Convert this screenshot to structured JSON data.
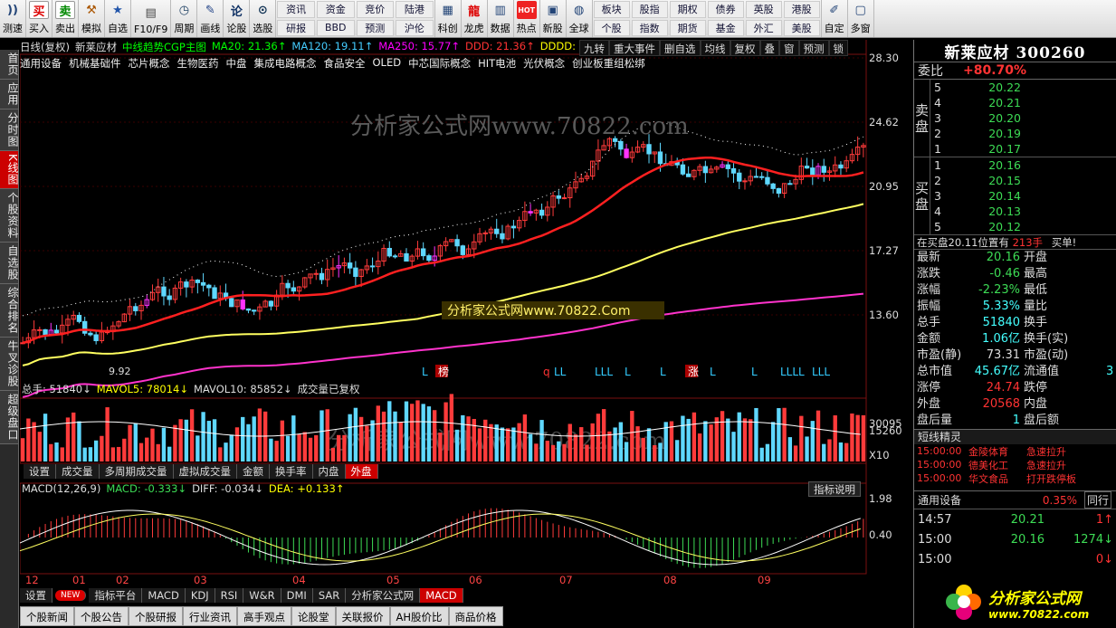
{
  "toolbar": {
    "items": [
      {
        "label": "测速",
        "icon": "wifi"
      },
      {
        "label": "买入",
        "icon": "买"
      },
      {
        "label": "卖出",
        "icon": "卖"
      },
      {
        "label": "模拟",
        "icon": "hammer"
      },
      {
        "label": "自选",
        "icon": "star"
      },
      {
        "label": "F10/F9",
        "icon": "info"
      },
      {
        "label": "周期",
        "icon": "clock"
      },
      {
        "label": "画线",
        "icon": "pen"
      },
      {
        "label": "论股",
        "icon": "论"
      },
      {
        "label": "选股",
        "icon": "search"
      }
    ],
    "grid1": [
      "资讯",
      "资金",
      "竞价",
      "陆港",
      "研报",
      "BBD",
      "预测",
      "沪伦"
    ],
    "items2": [
      {
        "label": "科创",
        "icon": "chart"
      },
      {
        "label": "龙虎",
        "icon": "dragon"
      },
      {
        "label": "数据",
        "icon": "data"
      },
      {
        "label": "热点",
        "icon": "hot"
      },
      {
        "label": "新股",
        "icon": "new"
      },
      {
        "label": "全球",
        "icon": "globe"
      }
    ],
    "grid2": [
      "板块",
      "股指",
      "期权",
      "债券",
      "英股",
      "港股",
      "个股",
      "指数",
      "期货",
      "基金",
      "外汇",
      "美股"
    ],
    "items3": [
      {
        "label": "自定",
        "icon": "custom"
      },
      {
        "label": "多窗",
        "icon": "win"
      }
    ]
  },
  "lefttabs": [
    "首页",
    "应用",
    "分时图",
    "K线图",
    "个股资料",
    "自选股",
    "综合排名",
    "牛叉诊股",
    "超级盘口"
  ],
  "chart": {
    "header1": [
      {
        "t": "日线(复权)",
        "c": "#ddd"
      },
      {
        "t": "新莱应材",
        "c": "#ddd"
      },
      {
        "t": "中线趋势CGP主图",
        "c": "#0f0"
      },
      {
        "t": "MA20: 21.36↑",
        "c": "#0f0"
      },
      {
        "t": "MA120: 19.11↑",
        "c": "#4cf"
      },
      {
        "t": "MA250: 15.77↑",
        "c": "#f0f"
      },
      {
        "t": "DDD: 21.36↑",
        "c": "#f33"
      },
      {
        "t": "DDDD: 1",
        "c": "#ff0"
      }
    ],
    "header2": [
      "通用设备",
      "机械基础件",
      "芯片概念",
      "生物医药",
      "中盘",
      "集成电路概念",
      "食品安全",
      "OLED",
      "中芯国际概念",
      "HIT电池",
      "光伏概念",
      "创业板重组松绑"
    ],
    "topbtns": [
      "九转",
      "重大事件",
      "删自选",
      "均线",
      "复权",
      "叠",
      "窗",
      "预测",
      "锁"
    ],
    "watermark1": "分析家公式网www.70822.com",
    "watermark2": "分析家公式网www.70822.Com",
    "price_ticks": [
      "28.30",
      "24.62",
      "20.95",
      "17.27",
      "13.60"
    ],
    "low_label": "9.92",
    "vol_header": [
      {
        "t": "总手: 51840↓",
        "c": "#ddd"
      },
      {
        "t": "MAVOL5: 78014↓",
        "c": "#ff0"
      },
      {
        "t": "MAVOL10: 85852↓",
        "c": "#ddd"
      },
      {
        "t": "成交量已复权",
        "c": "#ddd"
      }
    ],
    "vol_ticks": [
      "30095",
      "15260",
      "X10"
    ],
    "midtabs": [
      "设置",
      "成交量",
      "多周期成交量",
      "虚拟成交量",
      "金额",
      "换手率",
      "内盘",
      "外盘"
    ],
    "macd_header": [
      {
        "t": "MACD(12,26,9)",
        "c": "#ddd"
      },
      {
        "t": "MACD: -0.333↓",
        "c": "#3ddc55"
      },
      {
        "t": "DIFF: -0.034↓",
        "c": "#ddd"
      },
      {
        "t": "DEA: +0.133↑",
        "c": "#ff0"
      }
    ],
    "macd_btn": "指标说明",
    "macd_ticks": [
      "1.98",
      "0.40"
    ],
    "months": [
      "12",
      "01",
      "02",
      "03",
      "04",
      "05",
      "06",
      "07",
      "08",
      "09"
    ],
    "event_marks": [
      "L",
      "榜",
      "q",
      "LL",
      "LLL",
      "L",
      "L",
      "涨",
      "L",
      "L",
      "LLLL",
      "LLL"
    ],
    "bottomtabs": [
      {
        "t": "设置"
      },
      {
        "t": "NEW",
        "badge": true
      },
      {
        "t": "指标平台"
      },
      {
        "t": "MACD"
      },
      {
        "t": "KDJ"
      },
      {
        "t": "RSI"
      },
      {
        "t": "W&R"
      },
      {
        "t": "DMI"
      },
      {
        "t": "SAR"
      },
      {
        "t": "分析家公式网"
      },
      {
        "t": "MACD",
        "on": true
      }
    ],
    "newstabs": [
      "个股新闻",
      "个股公告",
      "个股研报",
      "行业资讯",
      "高手观点",
      "论股堂",
      "关联报价",
      "AH股价比",
      "商品价格"
    ]
  },
  "panel": {
    "title": "新莱应材 300260",
    "weibi_label": "委比",
    "weibi": "+80.70%",
    "sell_label": "卖盘",
    "buy_label": "买盘",
    "sells": [
      {
        "n": "5",
        "p": "20.22"
      },
      {
        "n": "4",
        "p": "20.21"
      },
      {
        "n": "3",
        "p": "20.20"
      },
      {
        "n": "2",
        "p": "20.19"
      },
      {
        "n": "1",
        "p": "20.17"
      }
    ],
    "buys": [
      {
        "n": "1",
        "p": "20.16"
      },
      {
        "n": "2",
        "p": "20.15"
      },
      {
        "n": "3",
        "p": "20.14"
      },
      {
        "n": "4",
        "p": "20.13"
      },
      {
        "n": "5",
        "p": "20.12"
      }
    ],
    "buyline": "在买盘20.11位置有",
    "buyline_q": "213手",
    "buyline_tail": "买单!",
    "details": [
      [
        "最新",
        "20.16",
        "开盘"
      ],
      [
        "涨跌",
        "-0.46",
        "最高"
      ],
      [
        "涨幅",
        "-2.23%",
        "最低"
      ],
      [
        "振幅",
        "5.33%",
        "量比"
      ],
      [
        "总手",
        "51840",
        "换手"
      ],
      [
        "金额",
        "1.06亿",
        "换手(实)"
      ],
      [
        "市盈(静)",
        "73.31",
        "市盈(动)"
      ],
      [
        "总市值",
        "45.67亿",
        "流通值"
      ],
      [
        "涨停",
        "24.74",
        "跌停"
      ],
      [
        "外盘",
        "20568",
        "内盘"
      ],
      [
        "盘后量",
        "1",
        "盘后额"
      ]
    ],
    "detail_colors": [
      "g",
      "g",
      "g",
      "c",
      "c",
      "c",
      "w",
      "c",
      "r",
      "r",
      "c"
    ],
    "ltv_tail": "3",
    "sprite_title": "短线精灵",
    "sprites": [
      [
        "15:00:00",
        "金陵体育",
        "急速拉升"
      ],
      [
        "15:00:00",
        "德美化工",
        "急速拉升"
      ],
      [
        "15:00:00",
        "华文食品",
        "打开跌停板"
      ]
    ],
    "sector": "通用设备",
    "sector_pct": "0.35%",
    "sector_btn": "同行",
    "ticks": [
      [
        "14:57",
        "20.21",
        "1↑"
      ],
      [
        "15:00",
        "20.16",
        "1274↓"
      ],
      [
        "15:00",
        "",
        "0↓"
      ]
    ],
    "logo": "分析家公式网",
    "logo_url": "www.70822.com"
  }
}
